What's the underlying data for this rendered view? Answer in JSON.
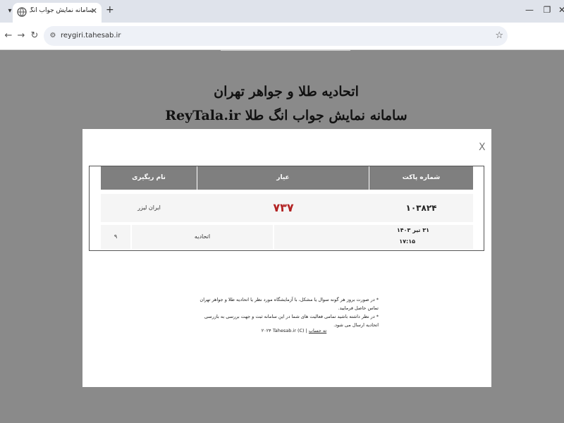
{
  "browser": {
    "tab_title": "سامانه نمایش جواب انگ طلا",
    "tab_menu_icon": "chevron-down-icon",
    "favicon": "globe-icon",
    "url": "reygiri.tahesab.ir",
    "window_controls": [
      "minimize-icon",
      "restore-icon",
      "close-icon"
    ]
  },
  "page": {
    "title": "اتحادیه طلا و جواهر تهران",
    "subtitle": "سامانه نمایش جواب انگ طلا ReyTala.ir"
  },
  "modal": {
    "close_label": "X",
    "table": {
      "headers": [
        "شماره پاکت",
        "عیار",
        "نام ریگیری"
      ],
      "row1": {
        "packet_number": "۱۰۳۸۲۴",
        "purity": "۷۳۷",
        "lab": "ایران لیزر"
      },
      "row2": {
        "date": "۳۱ تیر ۱۴۰۳",
        "time": "۱۷:۱۵",
        "org": "اتحادیه",
        "count": "۹"
      }
    },
    "notes": [
      "* در صورت بروز هر گونه سوال یا مشکل، با آزمایشگاه مورد نظر یا اتحادیه طلا و جواهر تهران تماس حاصل فرمایید.",
      "* در نظر داشته باشید تمامی فعالیت های شما در این سامانه ثبت و جهت بررسی به بازرسی اتحادیه ارسال می شود."
    ],
    "credit_link": "ته حساب",
    "credit_text": "(C) ۲۰۲۴ Tahesab.ir"
  },
  "colors": {
    "purity_red": "#b22222",
    "header_gray": "#7f7f7f",
    "backdrop": "#8a8a8a"
  }
}
